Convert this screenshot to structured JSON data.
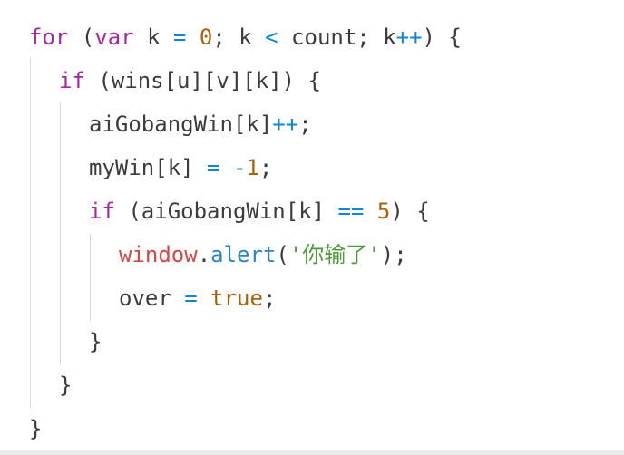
{
  "code": {
    "l1": {
      "kw_for": "for",
      "p1": " (",
      "kw_var": "var",
      "p2": " k ",
      "op_eq": "=",
      "sp": " ",
      "num0": "0",
      "p3": "; k ",
      "op_lt": "<",
      "p4": " count; k",
      "op_inc": "++",
      "p5": ") {"
    },
    "l2": {
      "kw_if": "if",
      "p1": " (wins[u][v][k]) {"
    },
    "l3": {
      "p1": "aiGobangWin[k]",
      "op_inc": "++",
      "p2": ";"
    },
    "l4": {
      "p1": "myWin[k] ",
      "op_eq": "=",
      "sp": " ",
      "op_minus": "-",
      "num1": "1",
      "p2": ";"
    },
    "l5": {
      "kw_if": "if",
      "p1": " (aiGobangWin[k] ",
      "op_eqeq": "==",
      "sp": " ",
      "num5": "5",
      "p2": ") {"
    },
    "l6": {
      "obj": "window",
      "dot": ".",
      "fn": "alert",
      "p1": "(",
      "str": "'你输了'",
      "p2": ");"
    },
    "l7": {
      "p1": "over ",
      "op_eq": "=",
      "sp": " ",
      "lit_true": "true",
      "p2": ";"
    },
    "l8": {
      "p1": "}"
    },
    "l9": {
      "p1": "}"
    },
    "l10": {
      "p1": "}"
    }
  },
  "colors": {
    "keyword": "#a626a4",
    "operator": "#0d84d8",
    "number": "#a9620a",
    "object": "#d64545",
    "function": "#2f83c9",
    "string": "#4f9a3e",
    "text": "#3b3b3b"
  }
}
